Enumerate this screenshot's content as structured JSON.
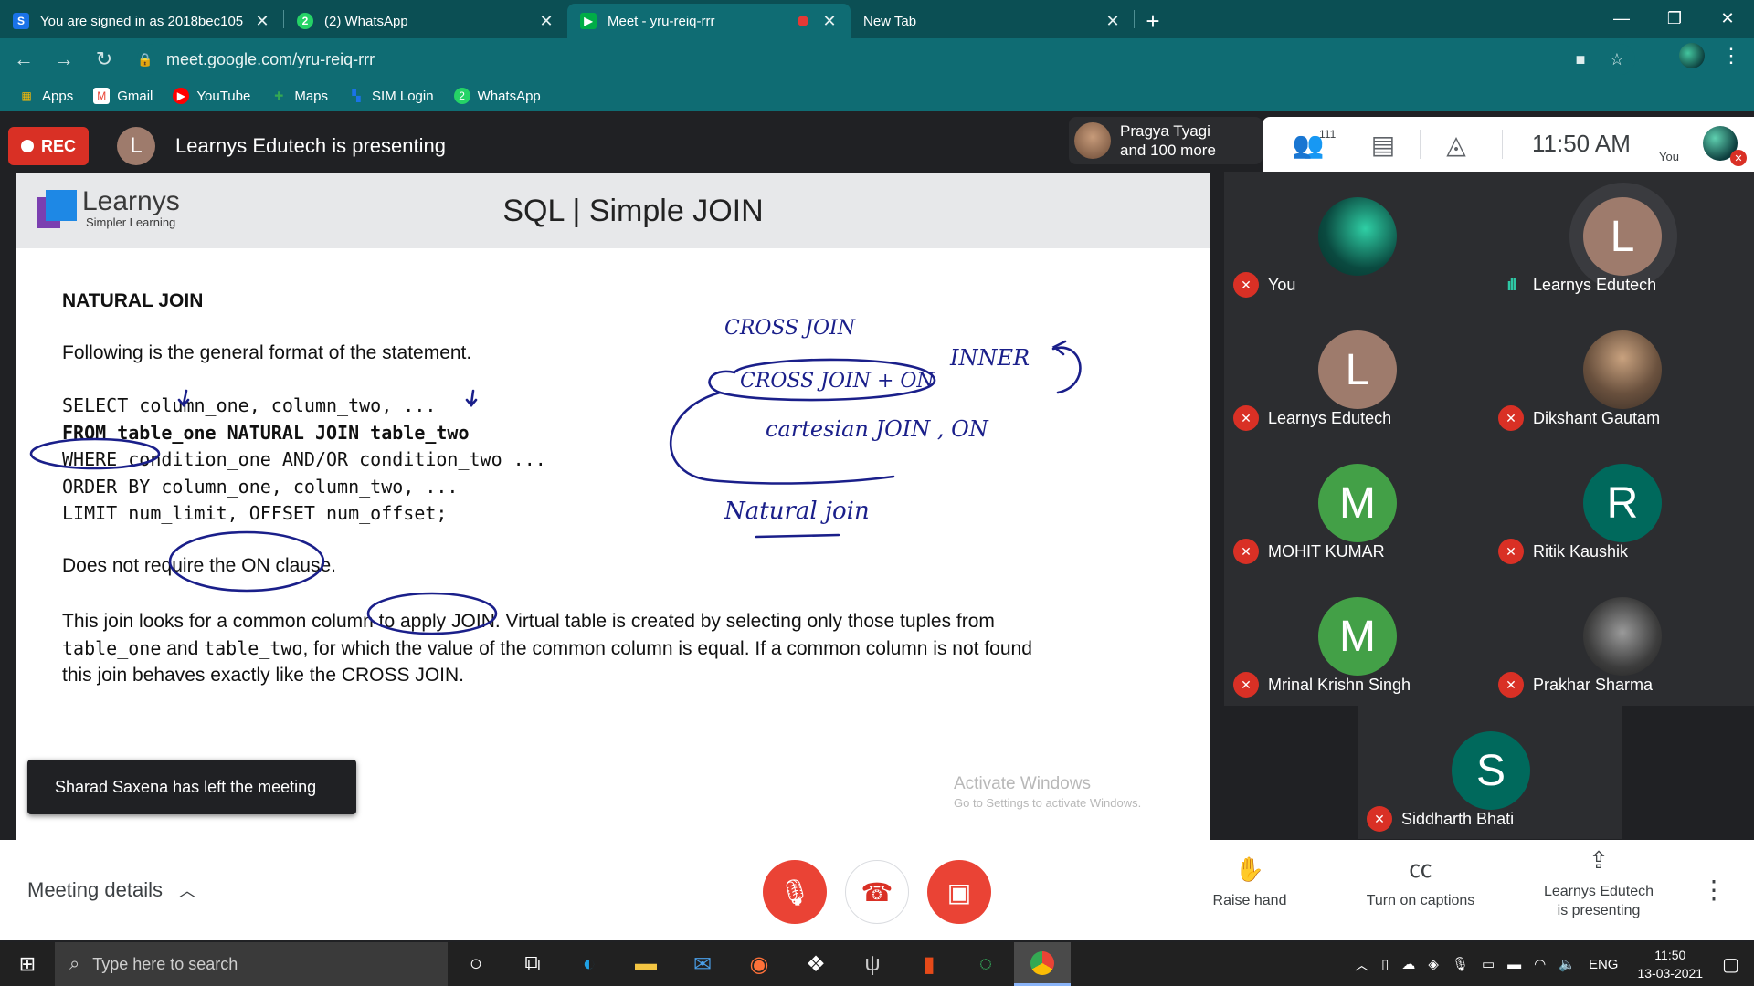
{
  "browser": {
    "tabs": [
      {
        "title": "You are signed in as 2018bec105",
        "icon": "s-icon",
        "icon_color": "#1a73e8"
      },
      {
        "title": "(2) WhatsApp",
        "icon": "whatsapp-icon",
        "icon_color": "#25d366"
      },
      {
        "title": "Meet - yru-reiq-rrr",
        "icon": "meet-icon",
        "icon_color": "#00ac47",
        "recording": true
      },
      {
        "title": "New Tab",
        "icon": "none"
      }
    ],
    "url": "meet.google.com/yru-reiq-rrr",
    "bookmarks": [
      {
        "label": "Apps",
        "icon": "apps-grid-icon",
        "color": "#ea4335"
      },
      {
        "label": "Gmail",
        "icon": "gmail-icon",
        "color": "#ea4335"
      },
      {
        "label": "YouTube",
        "icon": "youtube-icon",
        "color": "#ff0000"
      },
      {
        "label": "Maps",
        "icon": "maps-icon",
        "color": "#34a853"
      },
      {
        "label": "SIM Login",
        "icon": "sim-login-icon",
        "color": "#1a73e8"
      },
      {
        "label": "WhatsApp",
        "icon": "whatsapp-icon",
        "color": "#25d366"
      }
    ]
  },
  "meet": {
    "rec_label": "REC",
    "presenter_initial": "L",
    "presenter_text": "Learnys Edutech is presenting",
    "pragya": {
      "line1": "Pragya Tyagi",
      "line2": "and 100 more"
    },
    "participants_count": "111",
    "clock": "11:50  AM",
    "you_label": "You",
    "toast": "Sharad Saxena has left the meeting",
    "participants": [
      {
        "name": "You",
        "initial": "",
        "avatar": "photo",
        "color": "#0e6e5e",
        "muted": true
      },
      {
        "name": "Learnys Edutech",
        "initial": "L",
        "color": "#9e7b6c",
        "muted": false,
        "speaking": true
      },
      {
        "name": "Learnys Edutech",
        "initial": "L",
        "color": "#9e7b6c",
        "muted": true
      },
      {
        "name": "Dikshant Gautam",
        "initial": "",
        "avatar": "photo",
        "color": "#7a6250",
        "muted": true
      },
      {
        "name": "MOHIT KUMAR",
        "initial": "M",
        "color": "#43a047",
        "muted": true
      },
      {
        "name": "Ritik Kaushik",
        "initial": "R",
        "color": "#00695c",
        "muted": true
      },
      {
        "name": "Mrinal Krishn Singh",
        "initial": "M",
        "color": "#43a047",
        "muted": true
      },
      {
        "name": "Prakhar Sharma",
        "initial": "",
        "avatar": "photo",
        "color": "#555555",
        "muted": true
      },
      {
        "name": "Siddharth Bhati",
        "initial": "S",
        "color": "#00695c",
        "muted": true
      }
    ],
    "bottom": {
      "meeting_details": "Meeting details",
      "raise_hand": "Raise hand",
      "captions": "Turn on captions",
      "presenting_line1": "Learnys Edutech",
      "presenting_line2": "is presenting"
    }
  },
  "slide": {
    "brand": "Learnys",
    "tagline": "Simpler Learning",
    "title": "SQL | Simple JOIN",
    "heading": "NATURAL JOIN",
    "intro": "Following is the general format of the statement.",
    "code_line1": "SELECT column_one, column_two, ...",
    "code_line2": "FROM table_one NATURAL JOIN table_two",
    "code_line3": "WHERE condition_one AND/OR condition_two ...",
    "code_line4": "ORDER BY column_one, column_two, ...",
    "code_line5": "LIMIT num_limit, OFFSET num_offset;",
    "note": "Does not require the ON clause.",
    "para_a": "This join looks for a common column to apply JOIN. Virtual table is created by selecting only those tuples from",
    "para_b1": "table_one",
    "para_b2": " and ",
    "para_b3": "table_two",
    "para_b4": ", for which the value of the common column is equal. If a common column is not found",
    "para_c": "this join behaves exactly like the CROSS JOIN.",
    "ink": {
      "cross_join": "CROSS JOIN",
      "cross_join_on": "CROSS JOIN + ON",
      "inner": "INNER",
      "cartesian": "cartesian JOIN , ON",
      "natural": "Natural join"
    },
    "activate1": "Activate Windows",
    "activate2": "Go to Settings to activate Windows."
  },
  "taskbar": {
    "search_placeholder": "Type here to search",
    "lang": "ENG",
    "time": "11:50",
    "date": "13-03-2021"
  }
}
